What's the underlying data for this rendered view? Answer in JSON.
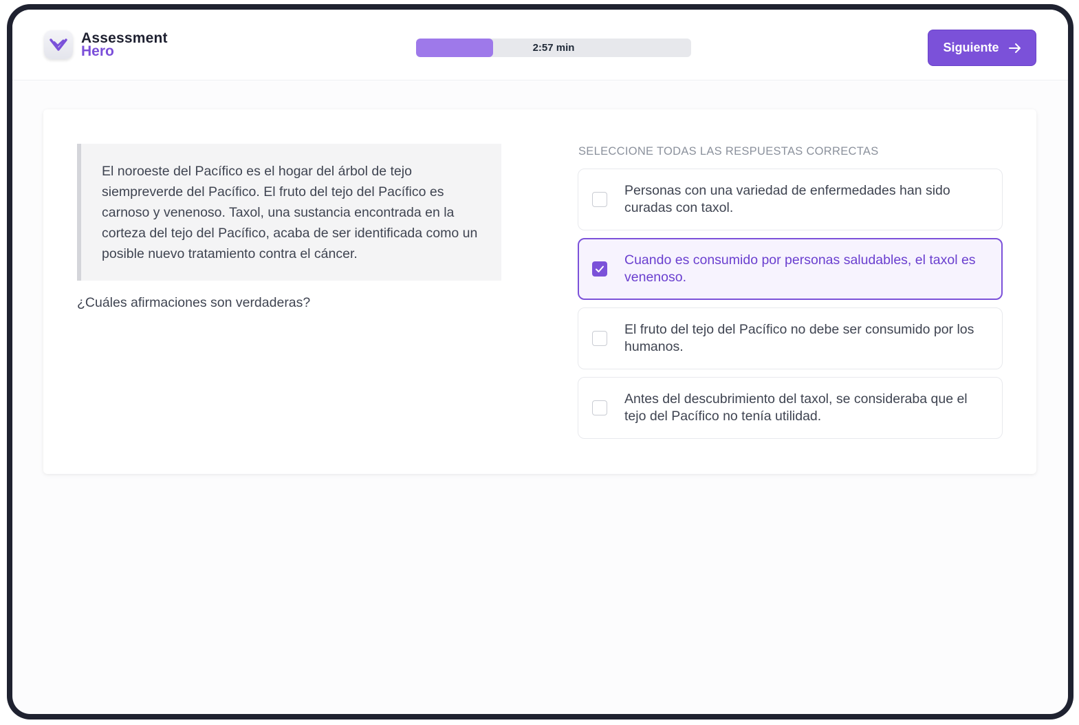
{
  "header": {
    "logo_line1": "Assessment",
    "logo_line2": "Hero",
    "logo_icon": "heart-check-icon",
    "timer": {
      "label": "2:57 min",
      "progress": 0.28
    },
    "next_button": {
      "label": "Siguiente",
      "icon": "arrow-right-icon"
    }
  },
  "passage": {
    "text": "El noroeste del Pacífico es el hogar del árbol de tejo siempreverde del Pacífico. El fruto del tejo del Pacífico es carnoso y venenoso. Taxol, una sustancia encontrada en la corteza del tejo del Pacífico, acaba de ser identificada como un posible nuevo tratamiento contra el cáncer."
  },
  "question": "¿Cuáles afirmaciones son verdaderas?",
  "answers": {
    "instructions": "SELECCIONE TODAS LAS RESPUESTAS CORRECTAS",
    "options": [
      {
        "text": "Personas con una variedad de enfermedades han sido curadas con taxol.",
        "checked": false
      },
      {
        "text": "Cuando es consumido por personas saludables, el taxol es venenoso.",
        "checked": true
      },
      {
        "text": "El fruto del tejo del Pacífico no debe ser consumido por los humanos.",
        "checked": false
      },
      {
        "text": "Antes del descubrimiento del taxol, se consideraba que el tejo del Pacífico no tenía utilidad.",
        "checked": false
      }
    ]
  },
  "colors": {
    "accent": "#7b51d9",
    "accent_light": "#f7f3fe",
    "timer_fill": "#9e79ea",
    "device_frame": "#1f2230"
  }
}
